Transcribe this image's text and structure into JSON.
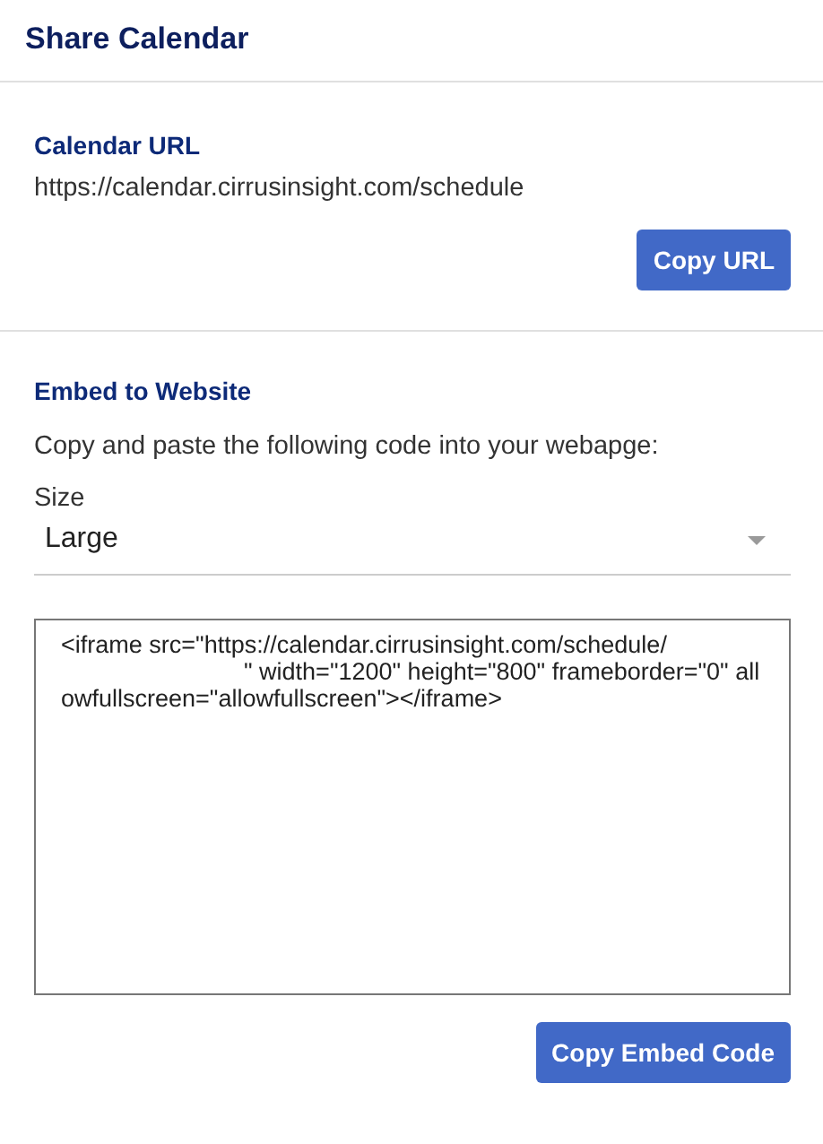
{
  "window": {
    "title": "Share Calendar"
  },
  "calendar_url": {
    "heading": "Calendar URL",
    "url": "https://calendar.cirrusinsight.com/schedule",
    "button": "Copy URL"
  },
  "embed": {
    "heading": "Embed to Website",
    "instructions": "Copy and paste the following code into your webapge:",
    "size_label": "Size",
    "size_value": "Large",
    "code_lines": [
      "<iframe src=\"https://calendar.cirrusinsight.com/schedule/",
      "\" width=\"1200\" height=\"800\" frameborder=\"0\" allowfullscreen=\"allowfullscreen\"></iframe>"
    ],
    "button": "Copy Embed Code"
  }
}
